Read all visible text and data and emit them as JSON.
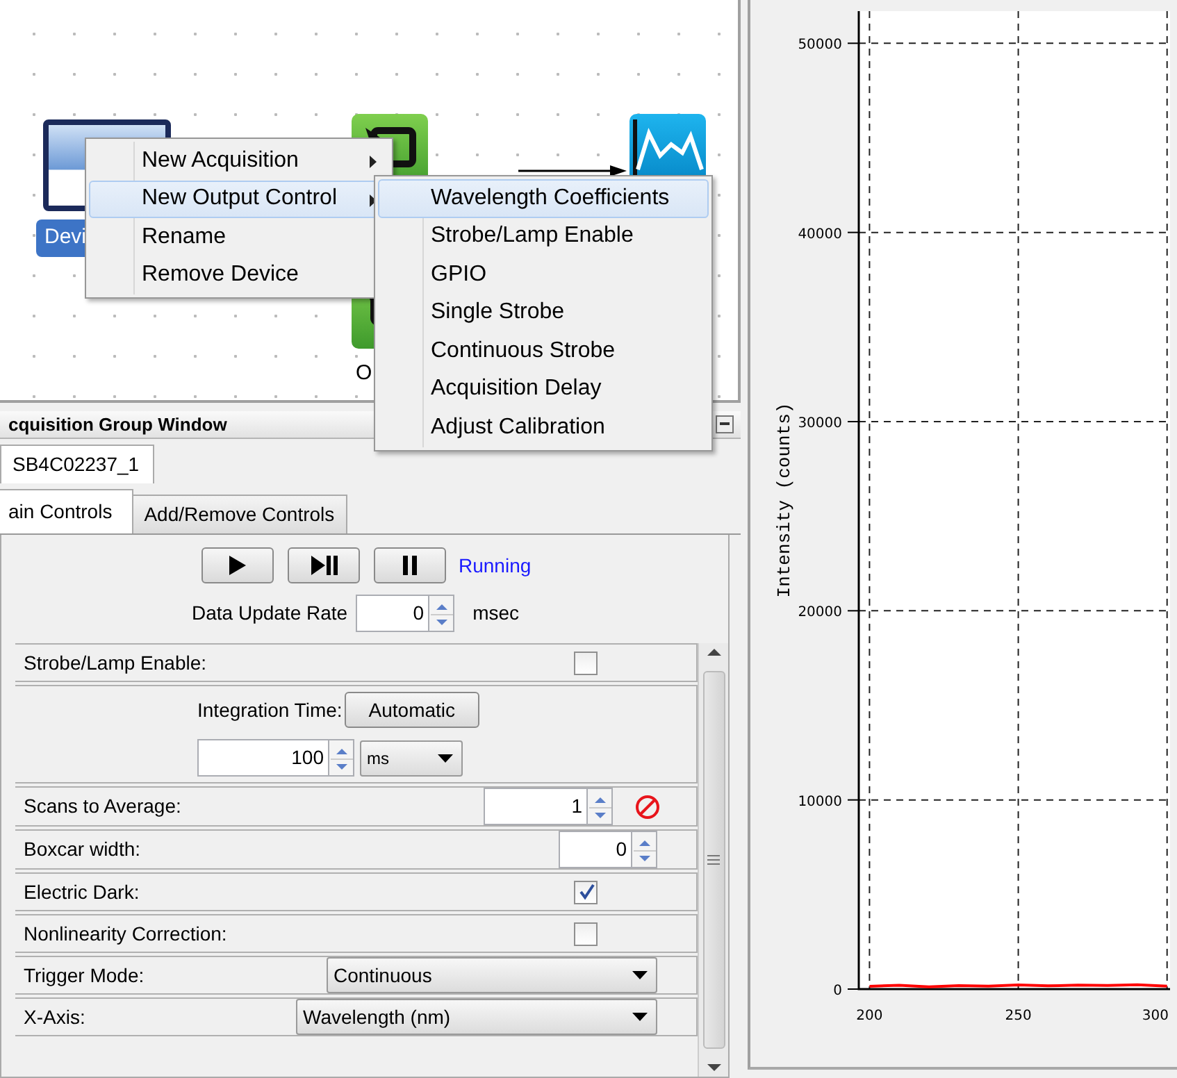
{
  "canvas": {
    "nodes": [
      {
        "kind": "device",
        "label": "Devi",
        "selected": true
      },
      {
        "kind": "acquisition",
        "selected": false
      },
      {
        "kind": "acquisition",
        "label": "O",
        "selected": false
      },
      {
        "kind": "graph",
        "selected": false
      }
    ]
  },
  "context_menu": {
    "items": [
      {
        "label": "New Acquisition",
        "submenu": true,
        "selected": false
      },
      {
        "label": "New Output Control",
        "submenu": true,
        "selected": true
      },
      {
        "label": "Rename",
        "submenu": false,
        "selected": false
      },
      {
        "label": "Remove Device",
        "submenu": false,
        "selected": false
      }
    ]
  },
  "submenu": {
    "items": [
      {
        "label": "Wavelength Coefficients",
        "selected": true
      },
      {
        "label": "Strobe/Lamp Enable",
        "selected": false
      },
      {
        "label": "GPIO",
        "selected": false
      },
      {
        "label": "Single Strobe",
        "selected": false
      },
      {
        "label": "Continuous Strobe",
        "selected": false
      },
      {
        "label": "Acquisition Delay",
        "selected": false
      },
      {
        "label": "Adjust Calibration",
        "selected": false
      }
    ]
  },
  "group_window": {
    "title": "cquisition Group Window",
    "device_tab": "SB4C02237_1",
    "tabs": [
      {
        "label": "ain Controls",
        "selected": true
      },
      {
        "label": "Add/Remove Controls",
        "selected": false
      }
    ],
    "status": "Running",
    "data_update_rate": {
      "label": "Data Update Rate",
      "value": "0",
      "unit": "msec"
    },
    "controls": [
      {
        "kind": "checkbox",
        "label": "Strobe/Lamp Enable:",
        "checked": false
      },
      {
        "kind": "integration",
        "label": "Integration Time:",
        "button": "Automatic",
        "value": "100",
        "unit": "ms"
      },
      {
        "kind": "spin",
        "label": "Scans to Average:",
        "value": "1",
        "reset": true
      },
      {
        "kind": "spin",
        "label": "Boxcar width:",
        "value": "0",
        "reset": false
      },
      {
        "kind": "checkbox",
        "label": "Electric Dark:",
        "checked": true
      },
      {
        "kind": "checkbox",
        "label": "Nonlinearity Correction:",
        "checked": false
      },
      {
        "kind": "dropdown",
        "label": "Trigger Mode:",
        "value": "Continuous"
      },
      {
        "kind": "dropdown",
        "label": "X-Axis:",
        "value": "Wavelength (nm)"
      }
    ]
  },
  "spectrum": {
    "chart_data": {
      "type": "line",
      "ylabel": "Intensity (counts)",
      "xlim": [
        196.4,
        301
      ],
      "ylim": [
        0,
        51700
      ],
      "xticks": [
        200,
        250,
        300
      ],
      "grid": true,
      "yticks": [
        0,
        10000,
        20000,
        30000,
        40000,
        50000
      ],
      "x": [
        200,
        210,
        220,
        230,
        240,
        250,
        260,
        270,
        280,
        290,
        300
      ],
      "series": [
        {
          "color": "#ff0000",
          "values": [
            150,
            200,
            120,
            180,
            160,
            220,
            170,
            210,
            190,
            230,
            160
          ]
        }
      ]
    }
  }
}
